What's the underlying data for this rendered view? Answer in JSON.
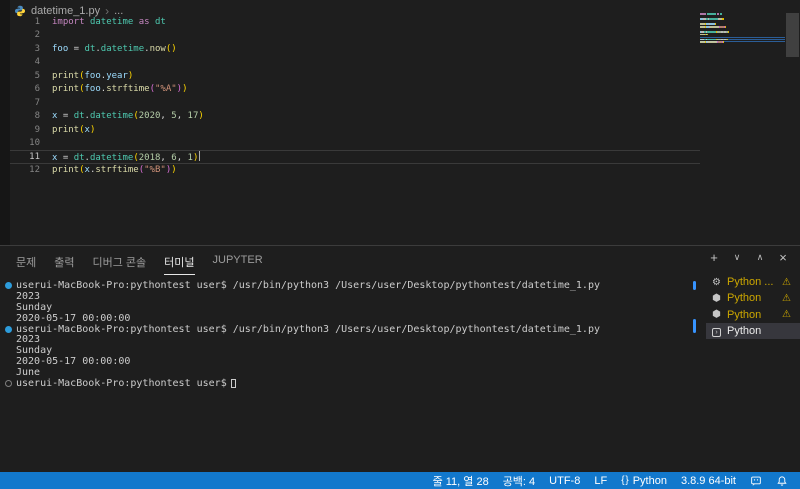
{
  "breadcrumb": {
    "file": "datetime_1.py",
    "separator": "›",
    "more": "..."
  },
  "editor": {
    "current_line": 11,
    "cursor": {
      "line": 11,
      "col": 28
    },
    "lines": [
      {
        "n": 1,
        "tokens": [
          [
            "kw",
            "import"
          ],
          [
            "pl",
            " "
          ],
          [
            "type",
            "datetime"
          ],
          [
            "pl",
            " "
          ],
          [
            "kw",
            "as"
          ],
          [
            "pl",
            " "
          ],
          [
            "type",
            "dt"
          ]
        ]
      },
      {
        "n": 2,
        "tokens": []
      },
      {
        "n": 3,
        "tokens": [
          [
            "var",
            "foo"
          ],
          [
            "pl",
            " = "
          ],
          [
            "type",
            "dt"
          ],
          [
            "pl",
            "."
          ],
          [
            "type",
            "datetime"
          ],
          [
            "pl",
            "."
          ],
          [
            "fn",
            "now"
          ],
          [
            "b1",
            "()"
          ]
        ]
      },
      {
        "n": 4,
        "tokens": []
      },
      {
        "n": 5,
        "tokens": [
          [
            "fn",
            "print"
          ],
          [
            "b1",
            "("
          ],
          [
            "var",
            "foo"
          ],
          [
            "pl",
            "."
          ],
          [
            "var",
            "year"
          ],
          [
            "b1",
            ")"
          ]
        ]
      },
      {
        "n": 6,
        "tokens": [
          [
            "fn",
            "print"
          ],
          [
            "b1",
            "("
          ],
          [
            "var",
            "foo"
          ],
          [
            "pl",
            "."
          ],
          [
            "fn",
            "strftime"
          ],
          [
            "b2",
            "("
          ],
          [
            "str",
            "\"%A\""
          ],
          [
            "b2",
            ")"
          ],
          [
            "b1",
            ")"
          ]
        ]
      },
      {
        "n": 7,
        "tokens": []
      },
      {
        "n": 8,
        "tokens": [
          [
            "var",
            "x"
          ],
          [
            "pl",
            " = "
          ],
          [
            "type",
            "dt"
          ],
          [
            "pl",
            "."
          ],
          [
            "type",
            "datetime"
          ],
          [
            "b1",
            "("
          ],
          [
            "num",
            "2020"
          ],
          [
            "pl",
            ", "
          ],
          [
            "num",
            "5"
          ],
          [
            "pl",
            ", "
          ],
          [
            "num",
            "17"
          ],
          [
            "b1",
            ")"
          ]
        ]
      },
      {
        "n": 9,
        "tokens": [
          [
            "fn",
            "print"
          ],
          [
            "b1",
            "("
          ],
          [
            "var",
            "x"
          ],
          [
            "b1",
            ")"
          ]
        ]
      },
      {
        "n": 10,
        "tokens": []
      },
      {
        "n": 11,
        "tokens": [
          [
            "var",
            "x"
          ],
          [
            "pl",
            " = "
          ],
          [
            "type",
            "dt"
          ],
          [
            "pl",
            "."
          ],
          [
            "type",
            "datetime"
          ],
          [
            "b1",
            "("
          ],
          [
            "num",
            "2018"
          ],
          [
            "pl",
            ", "
          ],
          [
            "num",
            "6"
          ],
          [
            "pl",
            ", "
          ],
          [
            "num",
            "1"
          ],
          [
            "b1",
            ")"
          ]
        ]
      },
      {
        "n": 12,
        "tokens": [
          [
            "fn",
            "print"
          ],
          [
            "b1",
            "("
          ],
          [
            "var",
            "x"
          ],
          [
            "pl",
            "."
          ],
          [
            "fn",
            "strftime"
          ],
          [
            "b2",
            "("
          ],
          [
            "str",
            "\"%B\""
          ],
          [
            "b2",
            ")"
          ],
          [
            "b1",
            ")"
          ]
        ]
      }
    ]
  },
  "panel": {
    "tabs": [
      {
        "label": "문제",
        "active": false
      },
      {
        "label": "출력",
        "active": false
      },
      {
        "label": "디버그 콘솔",
        "active": false
      },
      {
        "label": "터미널",
        "active": true
      },
      {
        "label": "JUPYTER",
        "active": false
      }
    ],
    "actions": [
      {
        "name": "new-terminal-button",
        "icon": "plus-icon",
        "glyph": "+"
      },
      {
        "name": "terminal-picker-dropdown",
        "icon": "chevron-down-icon",
        "glyph": "∨"
      },
      {
        "name": "maximize-panel-button",
        "icon": "chevron-up-icon",
        "glyph": "∧"
      },
      {
        "name": "close-panel-button",
        "icon": "close-icon",
        "glyph": "×"
      }
    ],
    "terminal_rows": [
      {
        "marker": "command",
        "text": "userui-MacBook-Pro:pythontest user$ /usr/bin/python3 /Users/user/Desktop/pythontest/datetime_1.py"
      },
      {
        "marker": "",
        "text": "2023"
      },
      {
        "marker": "",
        "text": "Sunday"
      },
      {
        "marker": "",
        "text": "2020-05-17 00:00:00"
      },
      {
        "marker": "command",
        "text": "userui-MacBook-Pro:pythontest user$ /usr/bin/python3 /Users/user/Desktop/pythontest/datetime_1.py"
      },
      {
        "marker": "",
        "text": "2023"
      },
      {
        "marker": "",
        "text": "Sunday"
      },
      {
        "marker": "",
        "text": "2020-05-17 00:00:00"
      },
      {
        "marker": "",
        "text": "June"
      },
      {
        "marker": "prompt",
        "text": "userui-MacBook-Pro:pythontest user$",
        "cursor": true
      }
    ],
    "terminal_list": [
      {
        "icon": "gear-icon",
        "label": "Python ...",
        "warning": true,
        "selected": false
      },
      {
        "icon": "cube-icon",
        "label": "Python",
        "warning": true,
        "selected": false
      },
      {
        "icon": "cube-icon",
        "label": "Python",
        "warning": true,
        "selected": false
      },
      {
        "icon": "terminal-icon",
        "label": "Python",
        "warning": false,
        "selected": true
      }
    ],
    "warning_glyph": "⚠"
  },
  "status_bar": {
    "items": [
      {
        "name": "cursor-position",
        "text": "줄 11, 열 28"
      },
      {
        "name": "indentation",
        "text": "공백: 4"
      },
      {
        "name": "encoding",
        "text": "UTF-8"
      },
      {
        "name": "eol",
        "text": "LF"
      },
      {
        "name": "language-mode",
        "text": "Python",
        "icon": "braces-icon"
      },
      {
        "name": "python-interpreter",
        "text": "3.8.9 64-bit"
      },
      {
        "name": "feedback",
        "text": "",
        "icon": "feedback-icon"
      },
      {
        "name": "notifications",
        "text": "",
        "icon": "bell-icon"
      }
    ]
  },
  "colors": {
    "status_bar": "#1278CC",
    "terminal_warning": "#CCA700",
    "command_marker": "#2D9CDB",
    "decoration_blue": "#3794FF"
  }
}
